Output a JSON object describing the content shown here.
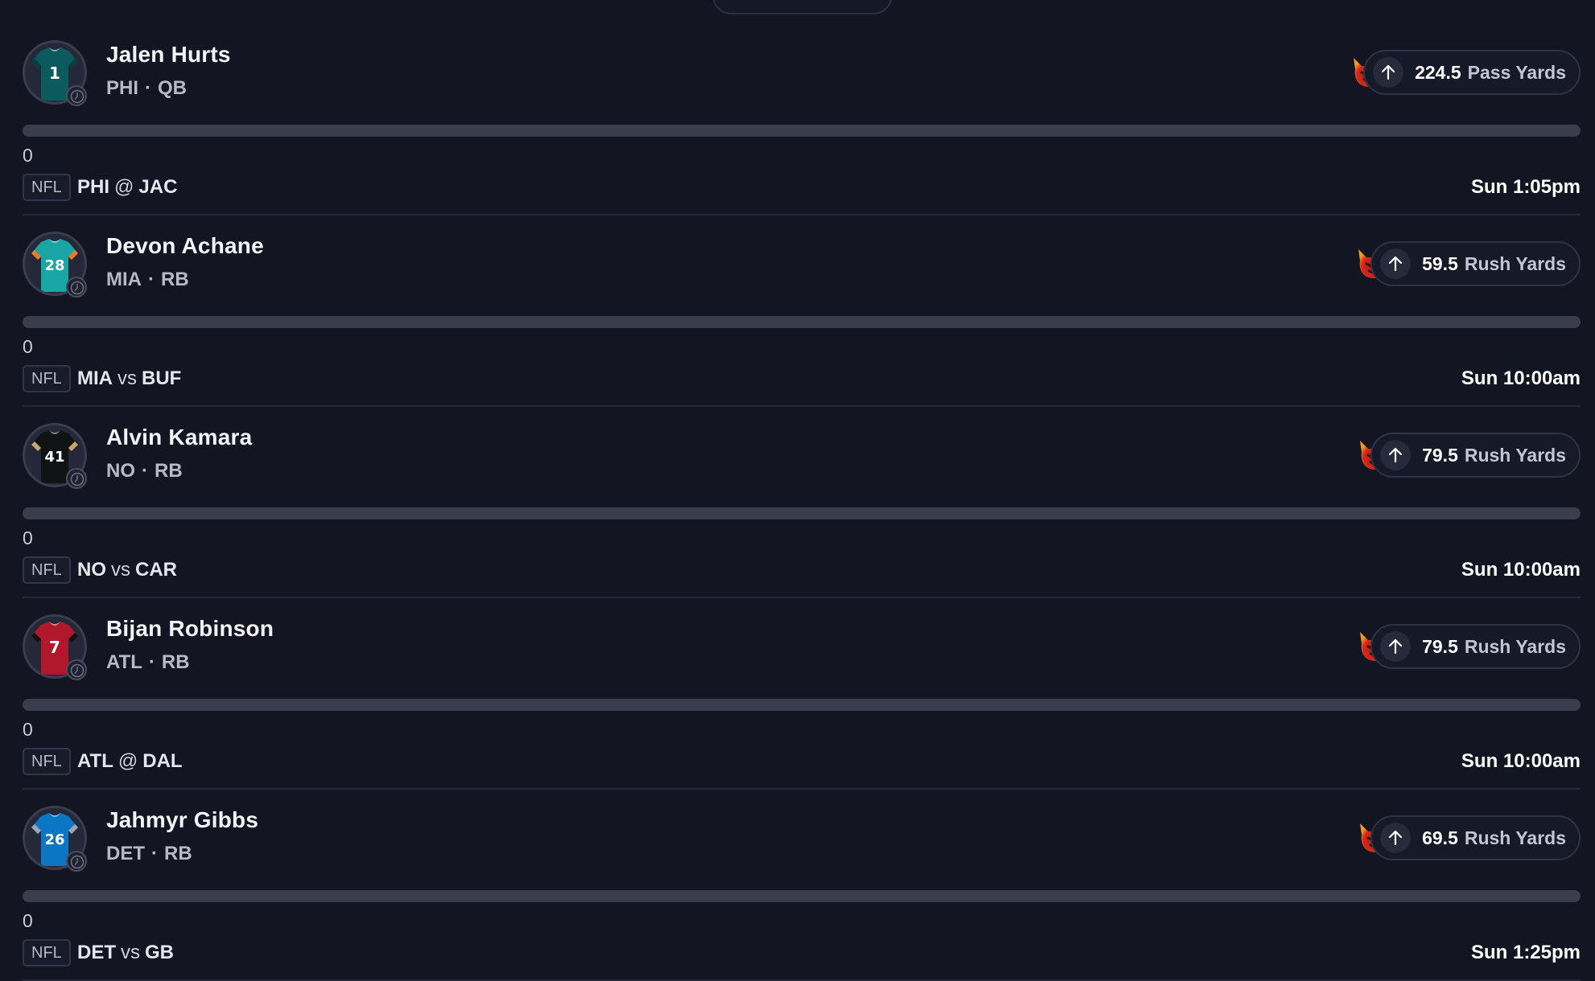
{
  "cards": [
    {
      "name": "Jalen Hurts",
      "team": "PHI",
      "position": "QB",
      "jersey_number": "1",
      "jersey_color": "#0b5a5e",
      "jersey_trim": "#0a3d40",
      "line": "224.5",
      "stat": "Pass Yards",
      "direction": "up-arrow-icon",
      "progress_value": "0",
      "progress_fraction": 0,
      "league": "NFL",
      "home": "PHI",
      "separator": "@",
      "away": "JAC",
      "time": "Sun 1:05pm"
    },
    {
      "name": "Devon Achane",
      "team": "MIA",
      "position": "RB",
      "jersey_number": "28",
      "jersey_color": "#1aa5a5",
      "jersey_trim": "#f07a2b",
      "line": "59.5",
      "stat": "Rush Yards",
      "direction": "up-arrow-icon",
      "progress_value": "0",
      "progress_fraction": 0,
      "league": "NFL",
      "home": "MIA",
      "separator": "vs",
      "away": "BUF",
      "time": "Sun 10:00am"
    },
    {
      "name": "Alvin Kamara",
      "team": "NO",
      "position": "RB",
      "jersey_number": "41",
      "jersey_color": "#101214",
      "jersey_trim": "#c7a86b",
      "line": "79.5",
      "stat": "Rush Yards",
      "direction": "up-arrow-icon",
      "progress_value": "0",
      "progress_fraction": 0,
      "league": "NFL",
      "home": "NO",
      "separator": "vs",
      "away": "CAR",
      "time": "Sun 10:00am"
    },
    {
      "name": "Bijan Robinson",
      "team": "ATL",
      "position": "RB",
      "jersey_number": "7",
      "jersey_color": "#b2182b",
      "jersey_trim": "#111111",
      "line": "79.5",
      "stat": "Rush Yards",
      "direction": "up-arrow-icon",
      "progress_value": "0",
      "progress_fraction": 0,
      "league": "NFL",
      "home": "ATL",
      "separator": "@",
      "away": "DAL",
      "time": "Sun 10:00am"
    },
    {
      "name": "Jahmyr Gibbs",
      "team": "DET",
      "position": "RB",
      "jersey_number": "26",
      "jersey_color": "#0b77c4",
      "jersey_trim": "#9ea7b0",
      "line": "69.5",
      "stat": "Rush Yards",
      "direction": "up-arrow-icon",
      "progress_value": "0",
      "progress_fraction": 0,
      "league": "NFL",
      "home": "DET",
      "separator": "vs",
      "away": "GB",
      "time": "Sun 1:25pm"
    }
  ],
  "colors": {
    "background": "#131522",
    "progress_track": "#3a3d4c",
    "devil_red": "#d7261f",
    "devil_orange": "#f29b22"
  }
}
